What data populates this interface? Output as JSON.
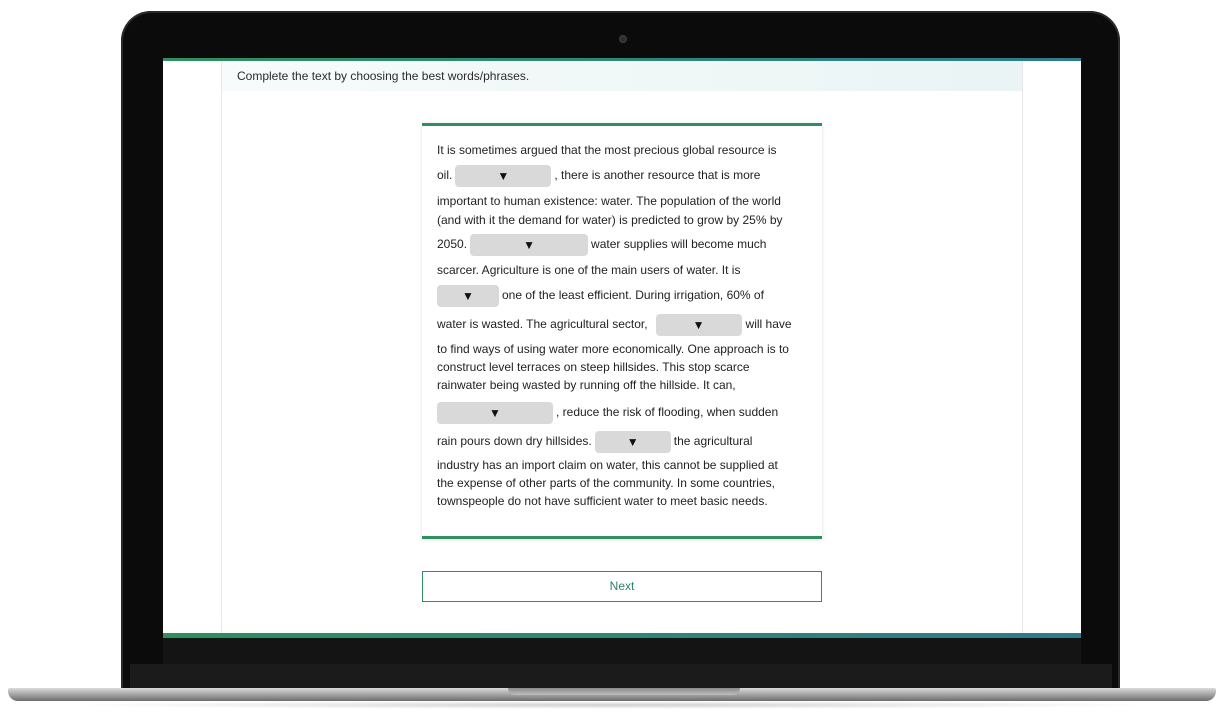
{
  "instruction": "Complete the text by choosing the best words/phrases.",
  "dropdown_glyph": "▼",
  "passage": {
    "l1": "It is sometimes argued that the most precious global resource is",
    "l2a": "oil.",
    "l2b": ", there is another resource that is more",
    "l3": "important to human existence: water. The population of the world",
    "l4": "(and with it the demand for water) is predicted to grow by 25% by",
    "l5a": "2050.",
    "l5b": "water supplies will become much",
    "l6": "scarcer. Agriculture is one of the main users of water. It is",
    "l7b": "one of the least efficient. During irrigation, 60% of",
    "l8a": "water is wasted. The agricultural sector,",
    "l8b": "will have",
    "l9": "to find ways of using water more economically. One approach is to",
    "l10": "construct level terraces on steep hillsides. This stop scarce",
    "l11": "rainwater being wasted by running off the hillside. It can,",
    "l12b": ", reduce the risk of flooding, when sudden",
    "l13a": "rain pours down dry hillsides.",
    "l13b": "the agricultural",
    "l14": "industry has an import claim on water, this cannot be supplied at",
    "l15": "the expense of other parts of the community. In some countries,",
    "l16": "townspeople do not have sufficient water to meet basic needs."
  },
  "next_label": "Next",
  "colors": {
    "accent": "#2f8f5e",
    "gap": "#d9d9d9"
  }
}
